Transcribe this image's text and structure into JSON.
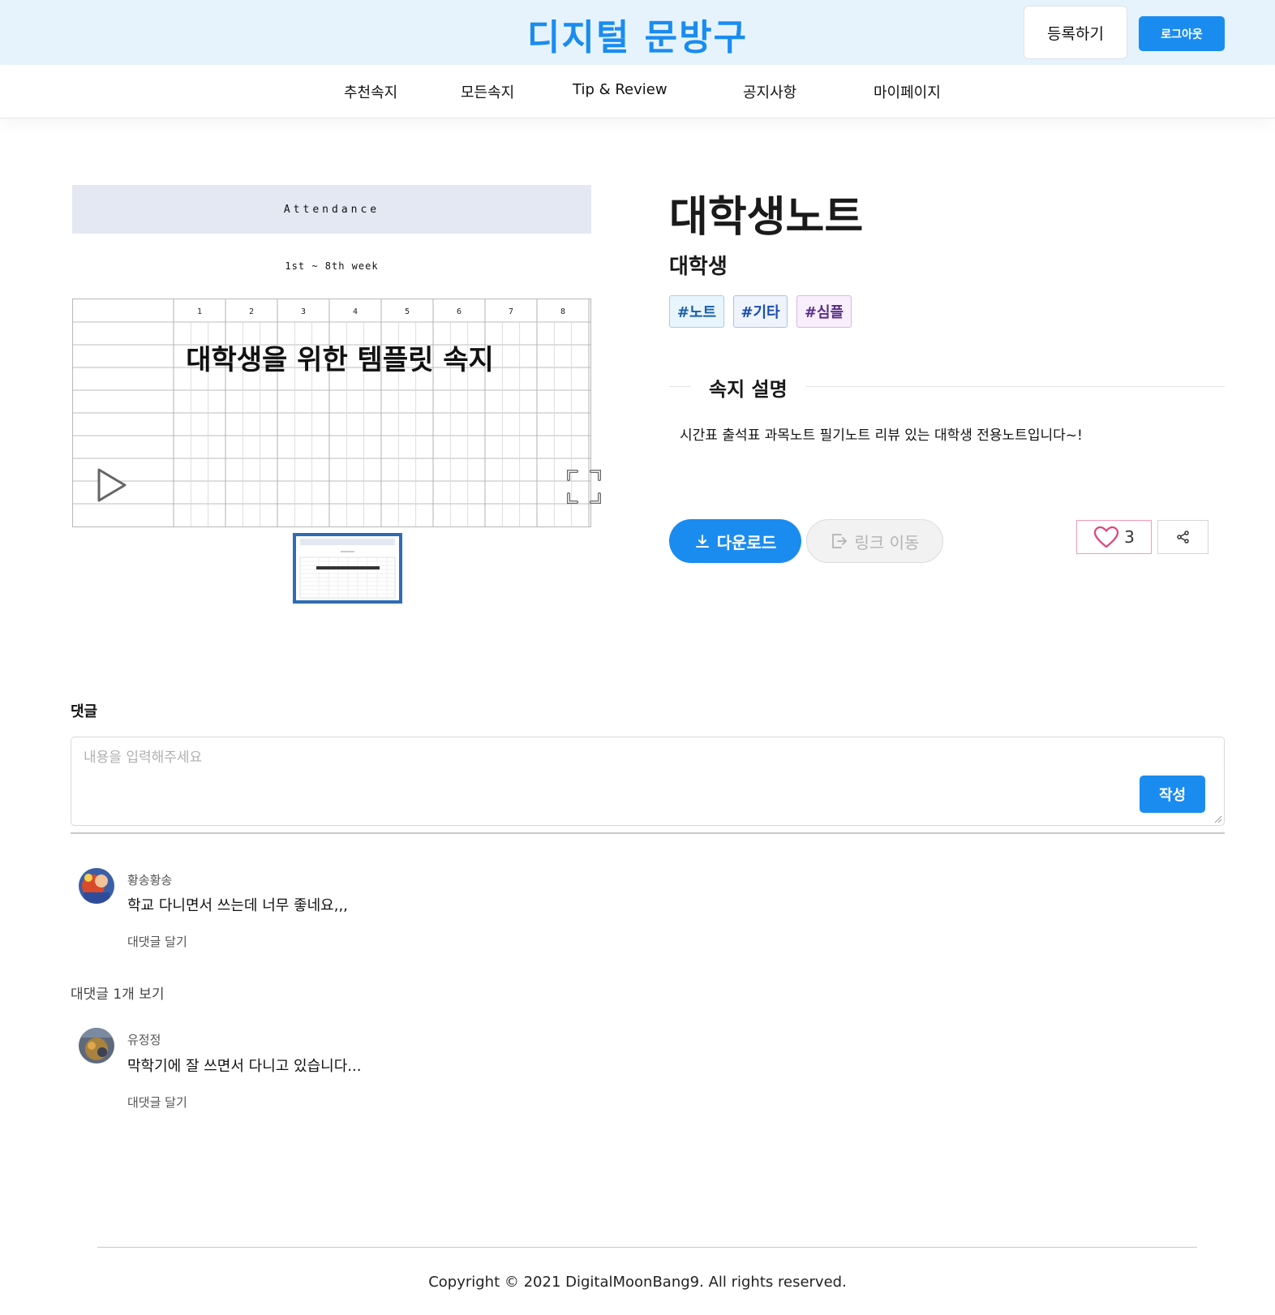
{
  "header": {
    "logo": "디지털 문방구",
    "register_label": "등록하기",
    "logout_label": "로그아웃"
  },
  "nav": {
    "items": [
      "추천속지",
      "모든속지",
      "Tip & Review",
      "공지사항",
      "마이페이지"
    ]
  },
  "preview": {
    "attendance_title": "Attendance",
    "week_range": "1st ~ 8th week",
    "grid_headers": [
      "1",
      "2",
      "3",
      "4",
      "5",
      "6",
      "7",
      "8"
    ],
    "overlay_title": "대학생을 위한 템플릿 속지"
  },
  "product": {
    "title": "대학생노트",
    "subtitle": "대학생",
    "tags": [
      "#노트",
      "#기타",
      "#심플"
    ],
    "description_heading": "속지 설명",
    "description": "시간표 출석표 과목노트 필기노트 리뷰 있는 대학생 전용노트입니다~!",
    "download_label": "다운로드",
    "link_label": "링크 이동",
    "like_count": "3"
  },
  "comments": {
    "heading": "댓글",
    "placeholder": "내용을 입력해주세요",
    "submit_label": "작성",
    "items": [
      {
        "author": "황송황송",
        "text": "학교 다니면서 쓰는데 너무 좋네요,,,",
        "reply_label": "대댓글 달기"
      },
      {
        "author": "유정정",
        "text": "막학기에 잘 쓰면서 다니고 있습니다...",
        "reply_label": "대댓글 달기"
      }
    ],
    "view_replies_label": "대댓글 1개 보기"
  },
  "footer": {
    "copyright": "Copyright © 2021 DigitalMoonBang9. All rights reserved."
  },
  "colors": {
    "brand": "#1a8cf0",
    "header_bg": "#e6f3fd",
    "like_border": "#f49bb6"
  },
  "icons": {
    "play": "play-icon",
    "fullscreen": "fullscreen-icon",
    "download": "download-icon",
    "link": "external-link-icon",
    "like": "heart-icon",
    "share": "share-icon"
  }
}
